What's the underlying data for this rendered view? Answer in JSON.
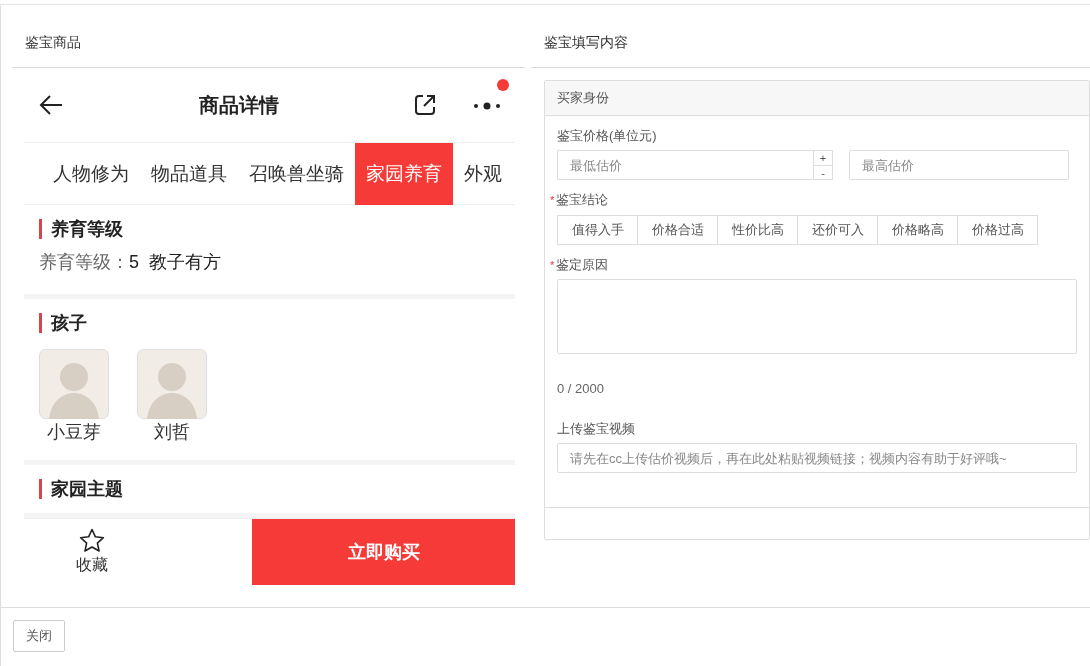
{
  "left_panel": {
    "title": "鉴宝商品",
    "phone": {
      "title": "商品详情",
      "more_badge": true,
      "tabs": [
        {
          "label": "人物修为",
          "selected": false
        },
        {
          "label": "物品道具",
          "selected": false
        },
        {
          "label": "召唤兽坐骑",
          "selected": false
        },
        {
          "label": "家园养育",
          "selected": true
        },
        {
          "label": "外观",
          "selected": false
        }
      ],
      "sections": [
        {
          "kind": "info",
          "heading": "养育等级",
          "label": "养育等级：",
          "values": [
            "5",
            "教子有方"
          ]
        },
        {
          "kind": "children",
          "heading": "孩子",
          "children": [
            {
              "name": "小豆芽"
            },
            {
              "name": "刘哲"
            }
          ]
        },
        {
          "kind": "heading",
          "heading": "家园主题"
        }
      ],
      "favorite_label": "收藏",
      "buy_button": "立即购买"
    }
  },
  "right_panel": {
    "title": "鉴宝填写内容",
    "card_header": "买家身份",
    "fields": [
      {
        "kind": "range",
        "label": "鉴宝价格(单位元)",
        "min_placeholder": "最低估价",
        "spinner_up": "+",
        "spinner_down": "-",
        "max_placeholder": "最高估价"
      },
      {
        "kind": "choices",
        "label": "鉴宝结论",
        "required_mark": "*",
        "options": [
          {
            "label": "值得入手",
            "selected": false
          },
          {
            "label": "价格合适",
            "selected": false
          },
          {
            "label": "性价比高",
            "selected": false
          },
          {
            "label": "还价可入",
            "selected": false
          },
          {
            "label": "价格略高",
            "selected": false
          },
          {
            "label": "价格过高",
            "selected": false
          }
        ]
      },
      {
        "kind": "textarea",
        "label": "鉴定原因",
        "required_mark": "*",
        "counter": "0 / 2000"
      },
      {
        "kind": "text",
        "label": "上传鉴宝视频",
        "placeholder": "请先在cc上传估价视频后，再在此处粘贴视频链接；视频内容有助于好评哦~"
      }
    ]
  },
  "footer": {
    "close_button": "关闭"
  }
}
